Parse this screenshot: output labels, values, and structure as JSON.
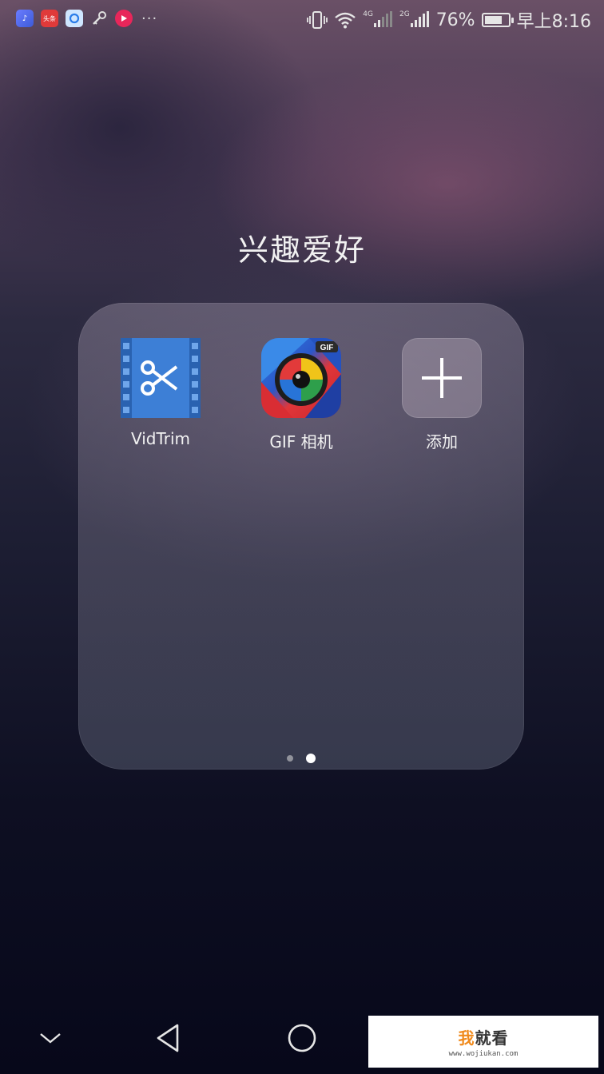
{
  "status_bar": {
    "notification_icons": [
      "music-icon",
      "toutiao-icon",
      "qq-browser-icon",
      "key-icon",
      "video-icon"
    ],
    "toutiao_text": "头条",
    "more": "···",
    "network_1": "4G",
    "network_2": "2G",
    "battery_percent": "76%",
    "battery_level": 0.76,
    "time": "早上8:16"
  },
  "folder": {
    "title": "兴趣爱好",
    "apps": [
      {
        "label": "VidTrim",
        "icon": "vidtrim-scissors-film-icon"
      },
      {
        "label": "GIF 相机",
        "icon": "gif-camera-lens-icon"
      },
      {
        "label": "添加",
        "icon": "plus-icon"
      }
    ],
    "gif_badge": "GIF",
    "page_count": 2,
    "active_page": 2
  },
  "nav_bar": {
    "buttons": [
      "chevron-down-icon",
      "back-triangle-icon",
      "home-circle-icon"
    ]
  },
  "watermark": {
    "title_first": "我",
    "title_rest": "就看",
    "url": "www.wojiukan.com"
  },
  "colors": {
    "vidtrim": "#3d7fd6",
    "gif_red": "#e0363a",
    "gif_blue": "#2f7de3"
  }
}
